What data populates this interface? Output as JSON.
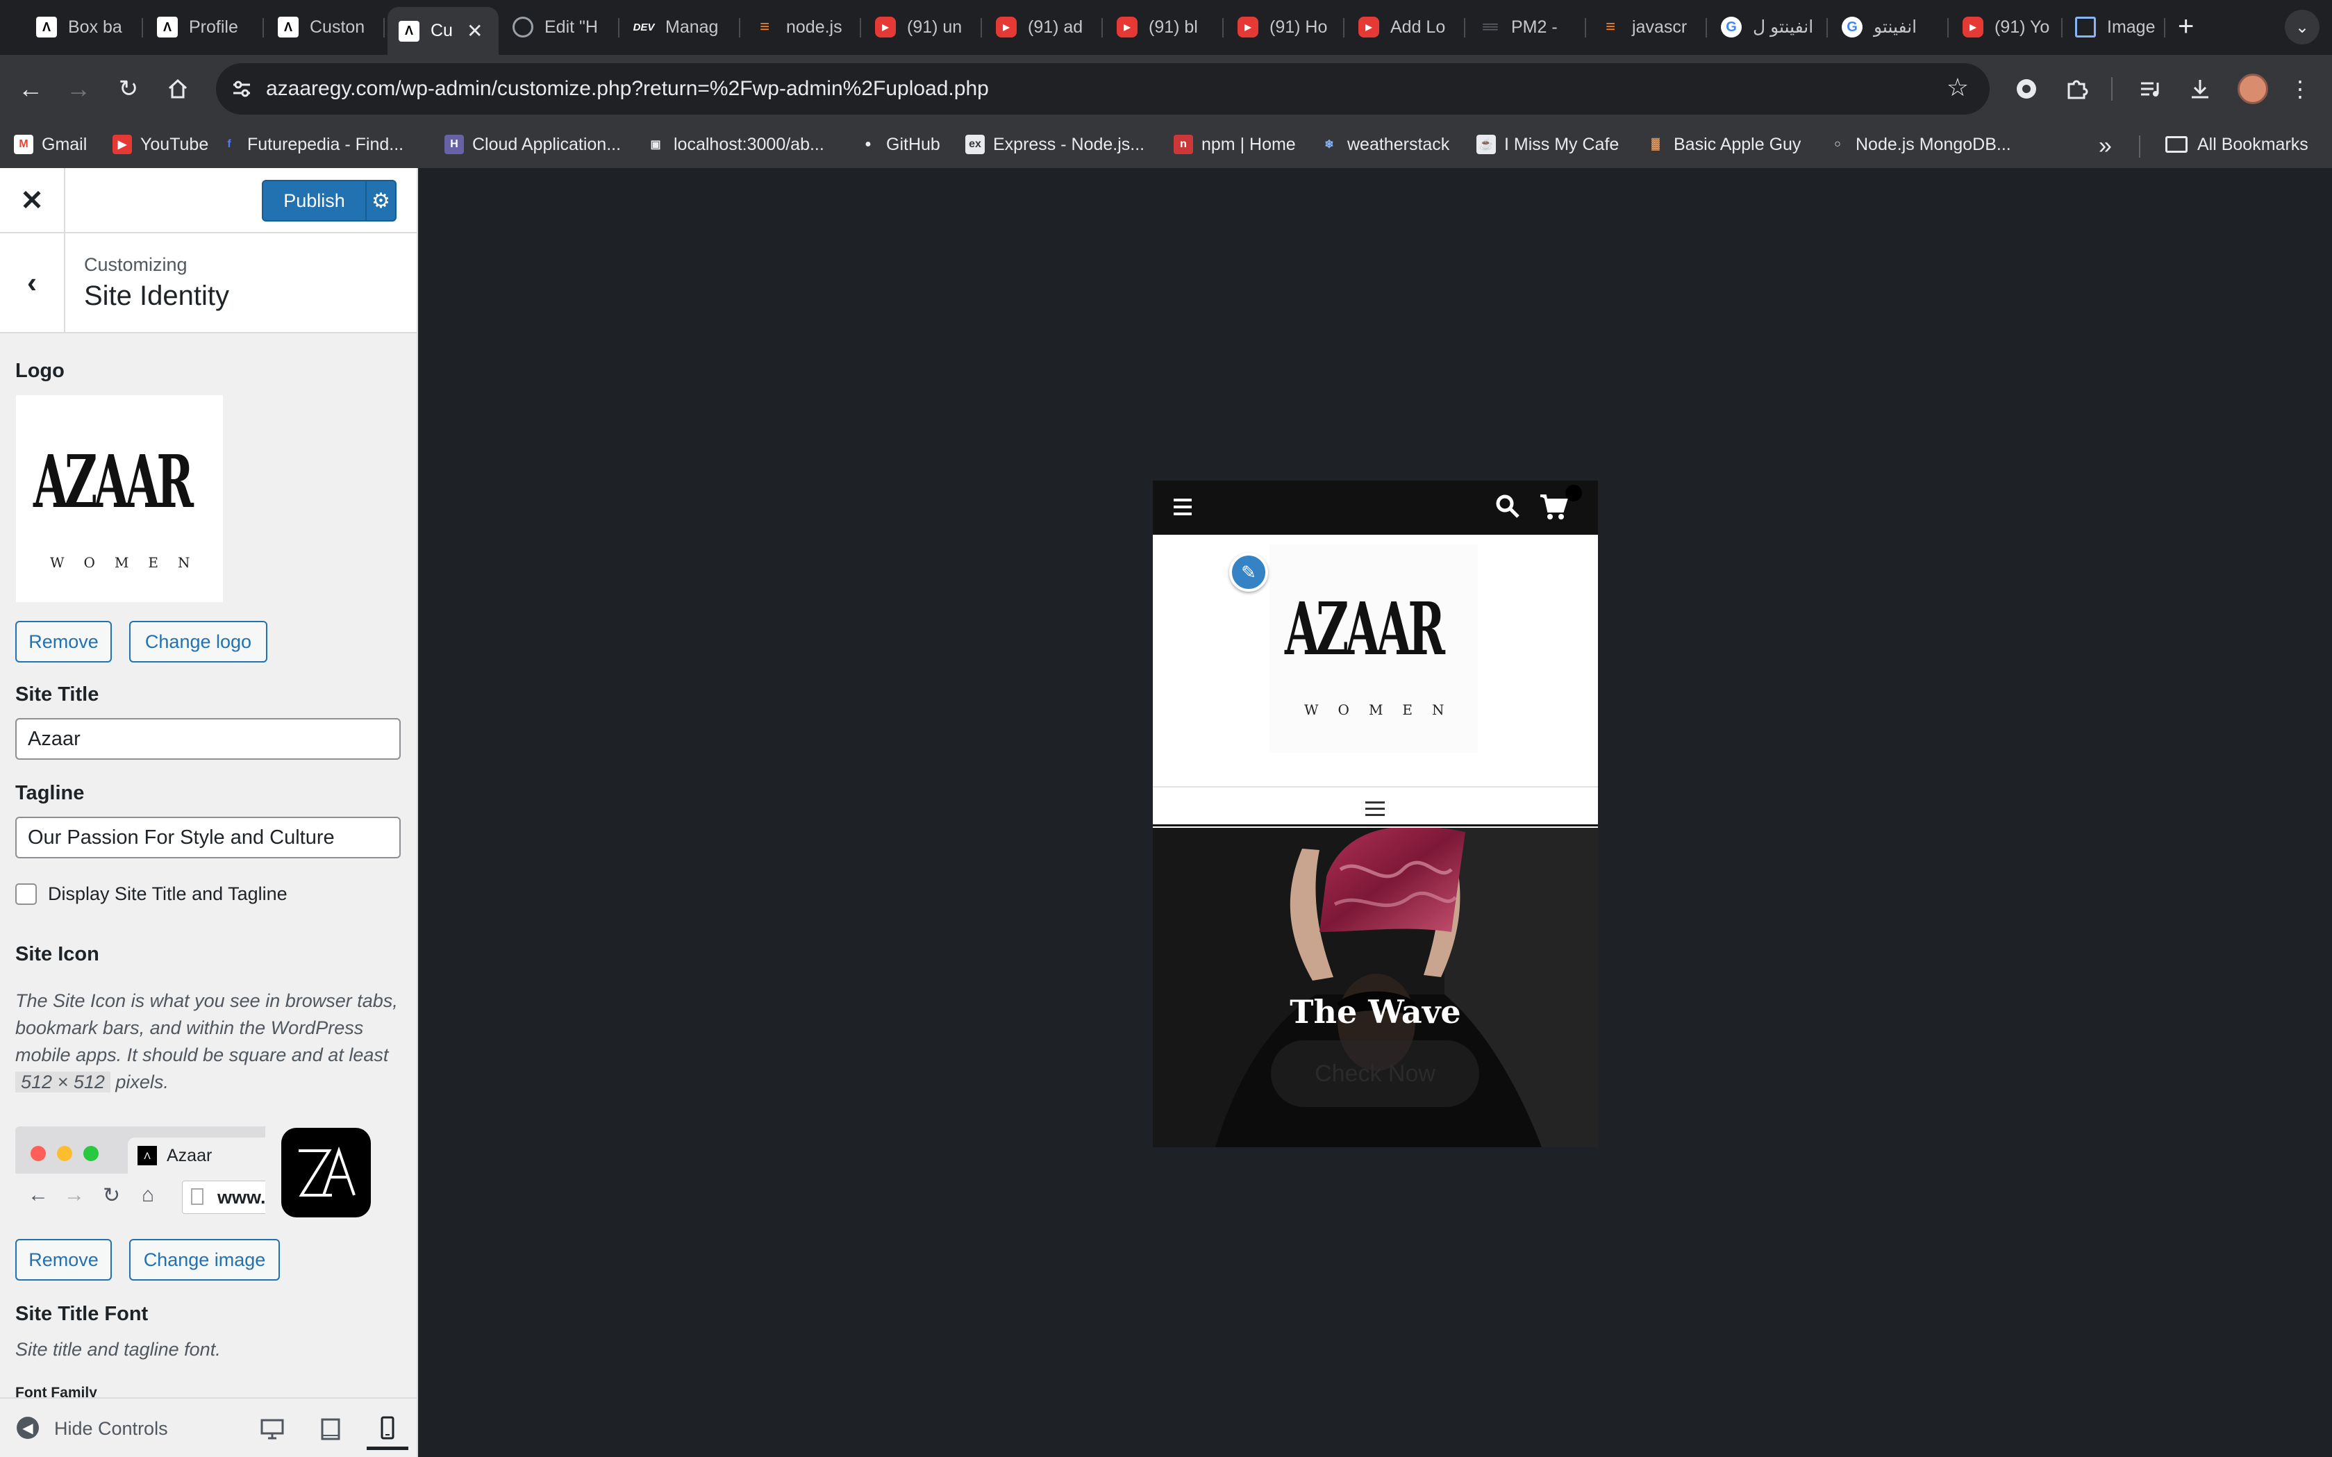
{
  "browser": {
    "tabs": [
      {
        "label": "Box ba",
        "icon": "azaar-favicon"
      },
      {
        "label": "Profile",
        "icon": "azaar-favicon"
      },
      {
        "label": "Custon",
        "icon": "azaar-favicon"
      },
      {
        "label": "Cu",
        "icon": "azaar-favicon",
        "active": true
      },
      {
        "label": "Edit \"H",
        "icon": "globe-icon"
      },
      {
        "label": "Manag",
        "icon": "dev-icon"
      },
      {
        "label": "node.js",
        "icon": "stackoverflow-icon"
      },
      {
        "label": "(91) un",
        "icon": "youtube-icon"
      },
      {
        "label": "(91) ad",
        "icon": "youtube-icon"
      },
      {
        "label": "(91) bl",
        "icon": "youtube-icon"
      },
      {
        "label": "(91) Ho",
        "icon": "youtube-icon"
      },
      {
        "label": "Add Lo",
        "icon": "youtube-icon"
      },
      {
        "label": "PM2 -",
        "icon": "pm2-icon"
      },
      {
        "label": "javascr",
        "icon": "stackoverflow-icon"
      },
      {
        "label": "انفينتو ل",
        "icon": "google-icon"
      },
      {
        "label": "انفينتو",
        "icon": "google-icon"
      },
      {
        "label": "(91) Yo",
        "icon": "youtube-icon"
      },
      {
        "label": "Image",
        "icon": "image-icon"
      }
    ],
    "url": "azaaregy.com/wp-admin/customize.php?return=%2Fwp-admin%2Fupload.php",
    "bookmarks": [
      {
        "label": "Gmail",
        "icon": "gmail-icon"
      },
      {
        "label": "YouTube",
        "icon": "youtube-icon"
      },
      {
        "label": "Futurepedia - Find...",
        "icon": "futurepedia-icon"
      },
      {
        "label": "Cloud Application...",
        "icon": "heroku-icon"
      },
      {
        "label": "localhost:3000/ab...",
        "icon": "image-icon"
      },
      {
        "label": "GitHub",
        "icon": "github-icon"
      },
      {
        "label": "Express - Node.js...",
        "icon": "express-icon"
      },
      {
        "label": "npm | Home",
        "icon": "npm-icon"
      },
      {
        "label": "weatherstack",
        "icon": "snowflake-icon"
      },
      {
        "label": "I Miss My Cafe",
        "icon": "cafe-icon"
      },
      {
        "label": "Basic Apple Guy",
        "icon": "apple-guy-icon"
      },
      {
        "label": "Node.js MongoDB...",
        "icon": "globe-icon"
      }
    ],
    "all_bookmarks": "All Bookmarks"
  },
  "customizer": {
    "publish_label": "Publish",
    "customizing_label": "Customizing",
    "section_title": "Site Identity",
    "logo": {
      "label": "Logo",
      "wordmark": "AZAAR",
      "sub": "WOMEN",
      "remove_label": "Remove",
      "change_label": "Change logo"
    },
    "site_title": {
      "label": "Site Title",
      "value": "Azaar"
    },
    "tagline": {
      "label": "Tagline",
      "value": "Our Passion For Style and Culture"
    },
    "display_checkbox": {
      "label": "Display Site Title and Tagline",
      "checked": false
    },
    "site_icon": {
      "label": "Site Icon",
      "description_before": "The Site Icon is what you see in browser tabs, bookmark bars, and within the WordPress mobile apps. It should be square and at least",
      "size_chip": "512 × 512",
      "description_after": "pixels.",
      "preview_tab_title": "Azaar",
      "preview_url": "www.",
      "icon_text": "ZA",
      "remove_label": "Remove",
      "change_label": "Change image"
    },
    "title_font": {
      "label": "Site Title Font",
      "description": "Site title and tagline font.",
      "font_family_label": "Font Family"
    },
    "hide_controls_label": "Hide Controls"
  },
  "preview": {
    "logo_wordmark": "AZAAR",
    "logo_sub": "WOMEN",
    "hero_title": "The Wave",
    "hero_button": "Check Now"
  },
  "colors": {
    "wp_blue": "#2271b1",
    "chrome_dark": "#36373a",
    "preview_bg": "#1e2125"
  }
}
